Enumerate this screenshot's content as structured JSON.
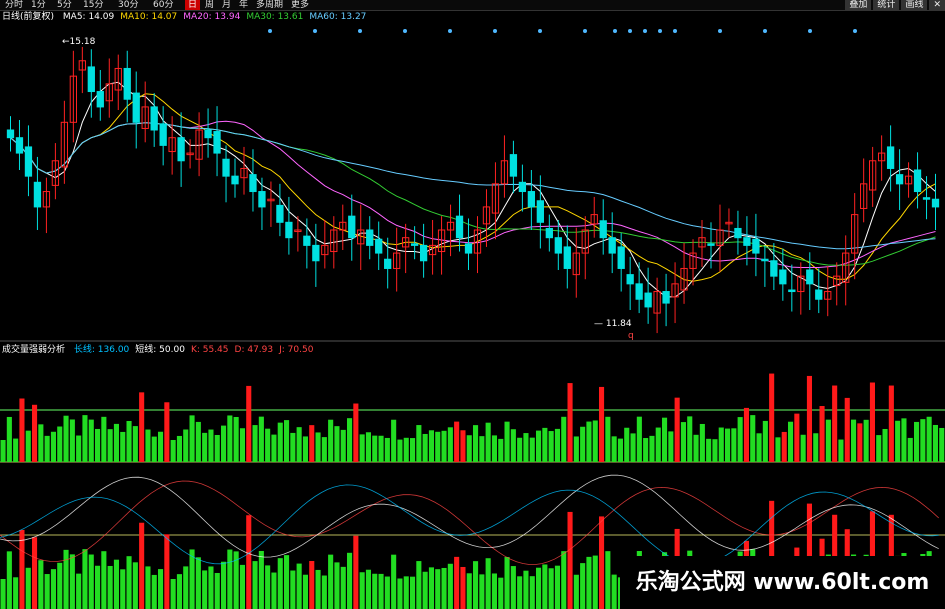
{
  "toolbar": {
    "items": [
      "分时",
      "1分",
      "5分",
      "15分",
      "30分",
      "60分",
      "日",
      "周",
      "月",
      "年",
      "多周期",
      "更多"
    ],
    "active_index": 6,
    "right_items": [
      "叠加",
      "统计",
      "画线",
      "✕"
    ]
  },
  "main_legend": {
    "title": "日线(前复权)",
    "ma": [
      {
        "label": "MA5: 14.09",
        "color": "#ffffff"
      },
      {
        "label": "MA10: 14.07",
        "color": "#ffd700"
      },
      {
        "label": "MA20: 13.94",
        "color": "#ff66ff"
      },
      {
        "label": "MA30: 13.61",
        "color": "#33cc33"
      },
      {
        "label": "MA60: 13.27",
        "color": "#66ccff"
      }
    ]
  },
  "annotations": {
    "high": "15.18",
    "low": "11.84",
    "marker": "q"
  },
  "sub_legend": {
    "title": "成交量强弱分析",
    "items": [
      {
        "label": "长线: 136.00",
        "color": "#00c0ff"
      },
      {
        "label": "短线: 50.00",
        "color": "#ffffff"
      },
      {
        "label": "K: 55.45",
        "color": "#ff4444"
      },
      {
        "label": "D: 47.93",
        "color": "#ff4444"
      },
      {
        "label": "J: 70.50",
        "color": "#ff4444"
      }
    ]
  },
  "watermark": {
    "text": "乐淘公式网 www.60lt.com"
  },
  "colors": {
    "up": "#ff2222",
    "down": "#00e0e0",
    "vol_up": "#ff1a1a",
    "vol_down": "#22dd22",
    "grid_green": "#66ff66",
    "grid_olive": "#b8b85a"
  },
  "chart_data": {
    "type": "candlestick",
    "candles_close": [
      14.1,
      13.9,
      13.6,
      13.2,
      13.4,
      13.8,
      14.3,
      14.9,
      15.1,
      14.7,
      14.5,
      14.8,
      15.0,
      14.6,
      14.3,
      14.5,
      14.2,
      14.0,
      14.1,
      13.8,
      13.9,
      14.2,
      14.1,
      13.9,
      13.6,
      13.5,
      13.7,
      13.4,
      13.2,
      13.3,
      13.0,
      12.8,
      12.9,
      12.7,
      12.5,
      12.7,
      12.9,
      13.0,
      12.8,
      12.9,
      12.7,
      12.6,
      12.4,
      12.6,
      12.8,
      12.7,
      12.5,
      12.7,
      12.9,
      13.0,
      12.8,
      12.6,
      12.9,
      13.2,
      13.5,
      13.8,
      13.6,
      13.4,
      13.2,
      13.0,
      12.8,
      12.6,
      12.4,
      12.6,
      12.9,
      13.1,
      12.8,
      12.6,
      12.4,
      12.2,
      12.0,
      11.9,
      12.1,
      11.95,
      12.2,
      12.4,
      12.6,
      12.8,
      12.7,
      12.9,
      13.0,
      12.8,
      12.7,
      12.6,
      12.5,
      12.3,
      12.2,
      12.1,
      12.3,
      12.2,
      12.0,
      12.1,
      12.3,
      12.6,
      13.1,
      13.5,
      13.8,
      13.9,
      13.7,
      13.5,
      13.6,
      13.4,
      13.3,
      13.2
    ]
  }
}
